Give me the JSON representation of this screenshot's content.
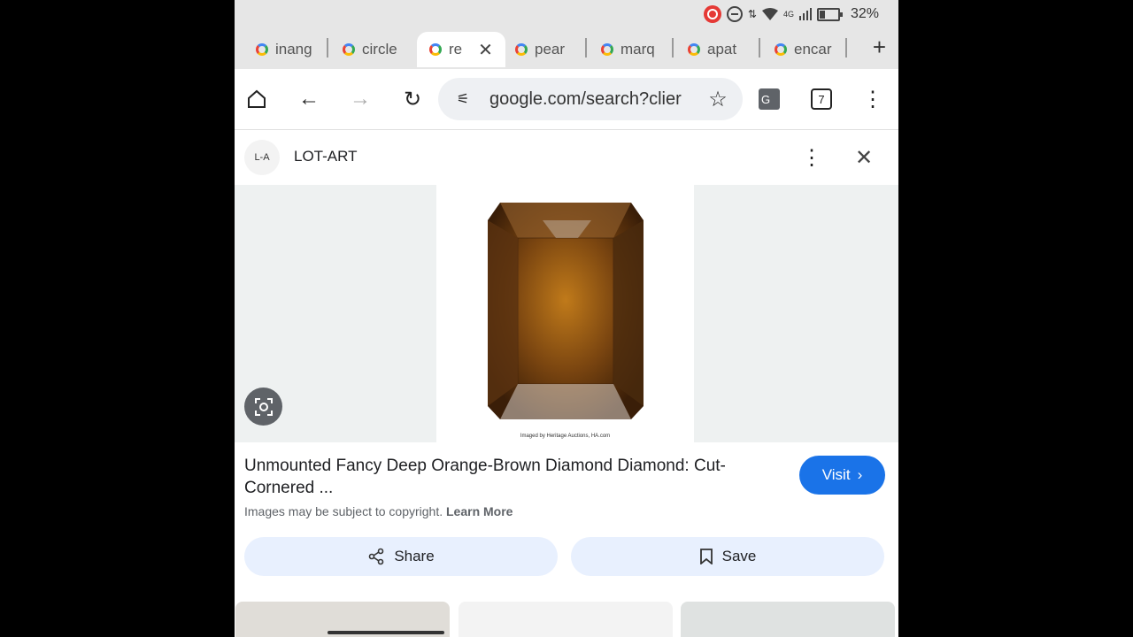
{
  "status": {
    "network": "4G",
    "battery": "32%"
  },
  "tabs": [
    {
      "label": "inang",
      "active": false
    },
    {
      "label": "circle",
      "active": false
    },
    {
      "label": "re",
      "active": true
    },
    {
      "label": "pear",
      "active": false
    },
    {
      "label": "marq",
      "active": false
    },
    {
      "label": "apat",
      "active": false
    },
    {
      "label": "encar",
      "active": false
    }
  ],
  "toolbar": {
    "url": "google.com/search?clier",
    "tab_count": "7"
  },
  "source": {
    "logo_text": "L-A",
    "name": "LOT-ART"
  },
  "image": {
    "caption": "Imaged by Heritage Auctions, HA.com"
  },
  "result": {
    "title": "Unmounted Fancy Deep Orange-Brown Diamond Diamond: Cut-Cornered ...",
    "visit_label": "Visit",
    "copyright_text": "Images may be subject to copyright.",
    "learn_more": "Learn More"
  },
  "actions": {
    "share_label": "Share",
    "save_label": "Save"
  },
  "colors": {
    "accent": "#1a73e8",
    "pill": "#e8f0fe",
    "tab_bar": "#e6e6e6"
  },
  "icons": [
    "home-icon",
    "back-icon",
    "forward-icon",
    "reload-icon",
    "tune-icon",
    "star-icon",
    "translate-icon",
    "more-vert-icon",
    "close-icon",
    "lens-icon",
    "share-icon",
    "bookmark-icon"
  ]
}
